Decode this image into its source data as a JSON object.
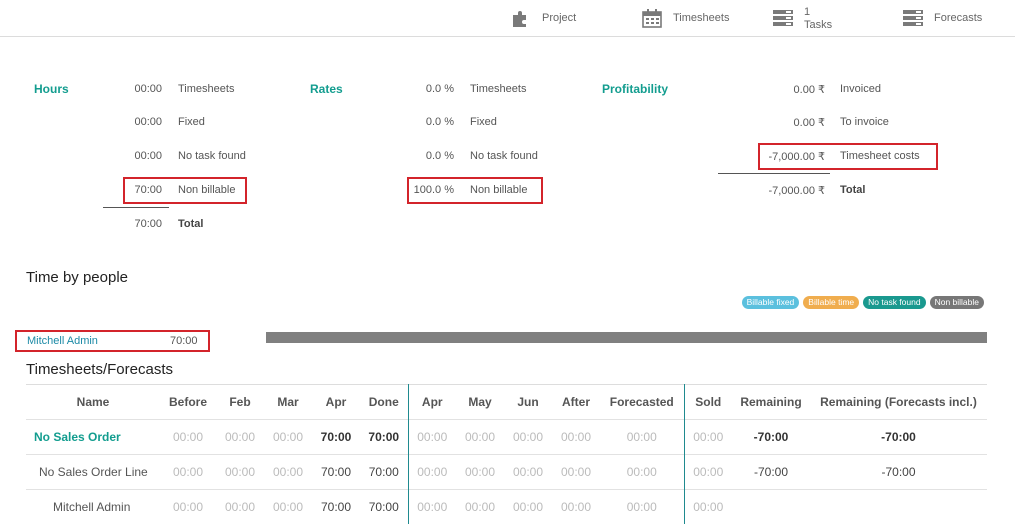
{
  "topbar": {
    "project": "Project",
    "timesheets": "Timesheets",
    "tasks_count": "1",
    "tasks": "Tasks",
    "forecasts": "Forecasts"
  },
  "summary": {
    "hours": {
      "title": "Hours",
      "rows": [
        {
          "value": "00:00",
          "label": "Timesheets"
        },
        {
          "value": "00:00",
          "label": "Fixed"
        },
        {
          "value": "00:00",
          "label": "No task found"
        },
        {
          "value": "70:00",
          "label": "Non billable"
        }
      ],
      "total": {
        "value": "70:00",
        "label": "Total"
      }
    },
    "rates": {
      "title": "Rates",
      "rows": [
        {
          "value": "0.0 %",
          "label": "Timesheets"
        },
        {
          "value": "0.0 %",
          "label": "Fixed"
        },
        {
          "value": "0.0 %",
          "label": "No task found"
        },
        {
          "value": "100.0 %",
          "label": "Non billable"
        }
      ]
    },
    "profitability": {
      "title": "Profitability",
      "rows": [
        {
          "value": "0.00 ₹",
          "label": "Invoiced"
        },
        {
          "value": "0.00 ₹",
          "label": "To invoice"
        },
        {
          "value": "-7,000.00 ₹",
          "label": "Timesheet costs"
        }
      ],
      "total": {
        "value": "-7,000.00 ₹",
        "label": "Total"
      }
    }
  },
  "time_by_people": {
    "title": "Time by people",
    "legend": [
      {
        "label": "Billable fixed",
        "color": "#5bc0de"
      },
      {
        "label": "Billable time",
        "color": "#f0ad4e"
      },
      {
        "label": "No task found",
        "color": "#1a998f"
      },
      {
        "label": "Non billable",
        "color": "#777777"
      }
    ],
    "people": [
      {
        "name": "Mitchell Admin",
        "hours": "70:00",
        "non_billable_pct": 100
      }
    ]
  },
  "timesheets_forecasts": {
    "title": "Timesheets/Forecasts",
    "headers": [
      "Name",
      "Before",
      "Feb",
      "Mar",
      "Apr",
      "Done",
      "Apr",
      "May",
      "Jun",
      "After",
      "Forecasted",
      "Sold",
      "Remaining",
      "Remaining (Forecasts incl.)"
    ],
    "rows": [
      {
        "name": "No Sales Order",
        "cells": [
          "00:00",
          "00:00",
          "00:00",
          "70:00",
          "70:00",
          "00:00",
          "00:00",
          "00:00",
          "00:00",
          "00:00",
          "00:00",
          "-70:00",
          "-70:00"
        ]
      },
      {
        "name": "No Sales Order Line",
        "cells": [
          "00:00",
          "00:00",
          "00:00",
          "70:00",
          "70:00",
          "00:00",
          "00:00",
          "00:00",
          "00:00",
          "00:00",
          "00:00",
          "-70:00",
          "-70:00"
        ]
      },
      {
        "name": "Mitchell Admin",
        "cells": [
          "00:00",
          "00:00",
          "00:00",
          "70:00",
          "70:00",
          "00:00",
          "00:00",
          "00:00",
          "00:00",
          "00:00",
          "00:00",
          "",
          ""
        ]
      }
    ]
  }
}
